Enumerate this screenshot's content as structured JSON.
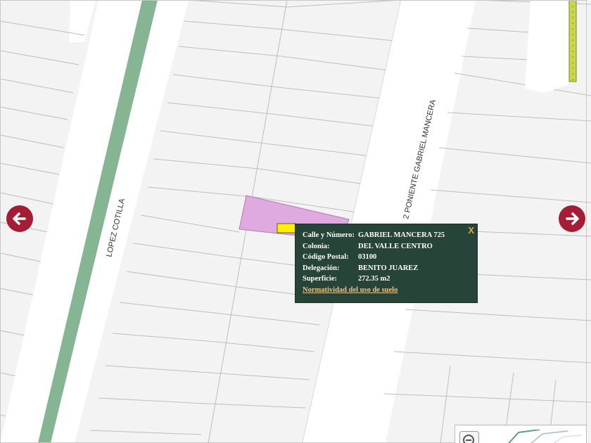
{
  "streets": {
    "left": "LOPEZ COTILLA",
    "right": "2 PONIENTE GABRIEL MANCERA"
  },
  "popup": {
    "close_label": "X",
    "rows": [
      {
        "label": "Calle y Número:",
        "value": "GABRIEL MANCERA 725"
      },
      {
        "label": "Colonia:",
        "value": "DEL VALLE CENTRO"
      },
      {
        "label": "Código Postal:",
        "value": "03100"
      },
      {
        "label": "Delegación:",
        "value": "BENITO JUAREZ"
      },
      {
        "label": "Superficie:",
        "value": "272.35 m2"
      }
    ],
    "link_label": "Normatividad del uso de suelo"
  },
  "navigation": {
    "prev_icon": "arrow-left-icon",
    "next_icon": "arrow-right-icon",
    "zoom_out_icon": "zoom-out-icon"
  },
  "colors": {
    "nav_button": "#a41d35",
    "popup_bg": "#274438",
    "selected_parcel": "#deaadf",
    "green_strip": "#86b593",
    "marker": "#ffee00"
  }
}
